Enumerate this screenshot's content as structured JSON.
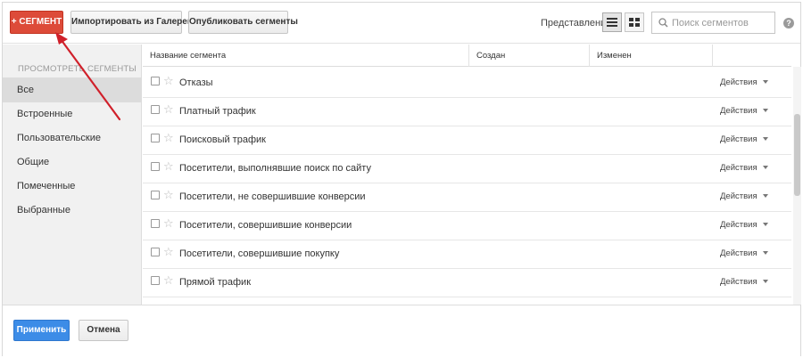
{
  "toolbar": {
    "add_segment_label": "+ СЕГМЕНТ",
    "import_label": "Импортировать из Галереи",
    "publish_label": "Опубликовать сегменты",
    "view_label": "Представление",
    "search_placeholder": "Поиск сегментов",
    "help_label": "?"
  },
  "sidebar": {
    "heading": "ПРОСМОТРЕТЬ СЕГМЕНТЫ",
    "items": [
      {
        "label": "Все",
        "active": true
      },
      {
        "label": "Встроенные"
      },
      {
        "label": "Пользовательские"
      },
      {
        "label": "Общие"
      },
      {
        "label": "Помеченные"
      },
      {
        "label": "Выбранные"
      }
    ]
  },
  "table": {
    "columns": [
      "Название сегмента",
      "Создан",
      "Изменен",
      ""
    ],
    "action_label": "Действия",
    "rows": [
      {
        "name": "Отказы"
      },
      {
        "name": "Платный трафик"
      },
      {
        "name": "Поисковый трафик"
      },
      {
        "name": "Посетители, выполнявшие поиск по сайту"
      },
      {
        "name": "Посетители, не совершившие конверсии"
      },
      {
        "name": "Посетители, совершившие конверсии"
      },
      {
        "name": "Посетители, совершившие покупку"
      },
      {
        "name": "Прямой трафик"
      }
    ]
  },
  "footer": {
    "apply_label": "Применить",
    "cancel_label": "Отмена"
  },
  "colors": {
    "add_button": "#dd4b39",
    "apply_button": "#3c8ce7",
    "annotation_arrow": "#d0202a"
  }
}
